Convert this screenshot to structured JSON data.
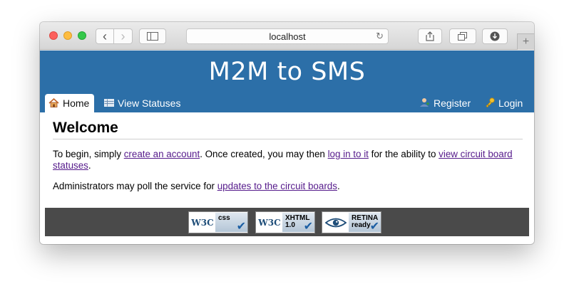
{
  "browser": {
    "address": "localhost",
    "back_icon": "‹",
    "forward_icon": "›",
    "reload_icon": "↻",
    "newtab_icon": "+"
  },
  "site": {
    "title": "M2M to SMS",
    "brand_color": "#2c6fa8"
  },
  "nav": {
    "home": "Home",
    "statuses": "View Statuses",
    "register": "Register",
    "login": "Login"
  },
  "content": {
    "heading": "Welcome",
    "p1_a": "To begin, simply ",
    "p1_link1": "create an account",
    "p1_b": ". Once created, you may then ",
    "p1_link2": "log in to it",
    "p1_c": " for the ability to ",
    "p1_link3": "view circuit board statuses",
    "p1_d": ".",
    "p2_a": "Administrators may poll the service for ",
    "p2_link": "updates to the circuit boards",
    "p2_b": "."
  },
  "badges": {
    "w3c": "W3C",
    "css": "css",
    "xhtml": "XHTML",
    "xhtml_version": "1.0",
    "retina": "RETINA",
    "retina_sub": "ready"
  }
}
